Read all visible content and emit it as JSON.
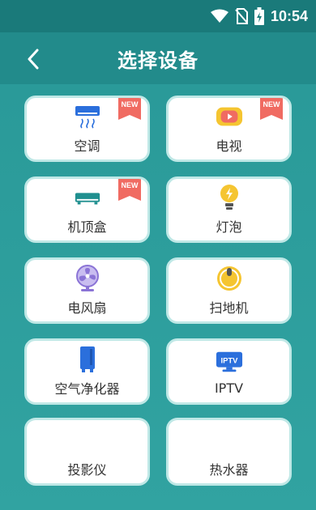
{
  "status_bar": {
    "time": "10:54"
  },
  "header": {
    "title": "选择设备"
  },
  "devices": [
    {
      "label": "空调",
      "badge": "NEW"
    },
    {
      "label": "电视",
      "badge": "NEW"
    },
    {
      "label": "机顶盒",
      "badge": "NEW"
    },
    {
      "label": "灯泡"
    },
    {
      "label": "电风扇"
    },
    {
      "label": "扫地机"
    },
    {
      "label": "空气净化器"
    },
    {
      "label": "IPTV",
      "icon_text": "IPTV"
    },
    {
      "label": "投影仪"
    },
    {
      "label": "热水器"
    }
  ],
  "colors": {
    "accent": "#228b8b",
    "badge": "#f06b62",
    "icon_blue": "#2b6fdc",
    "icon_purple": "#8b74d6",
    "icon_yellow": "#f5c531"
  }
}
